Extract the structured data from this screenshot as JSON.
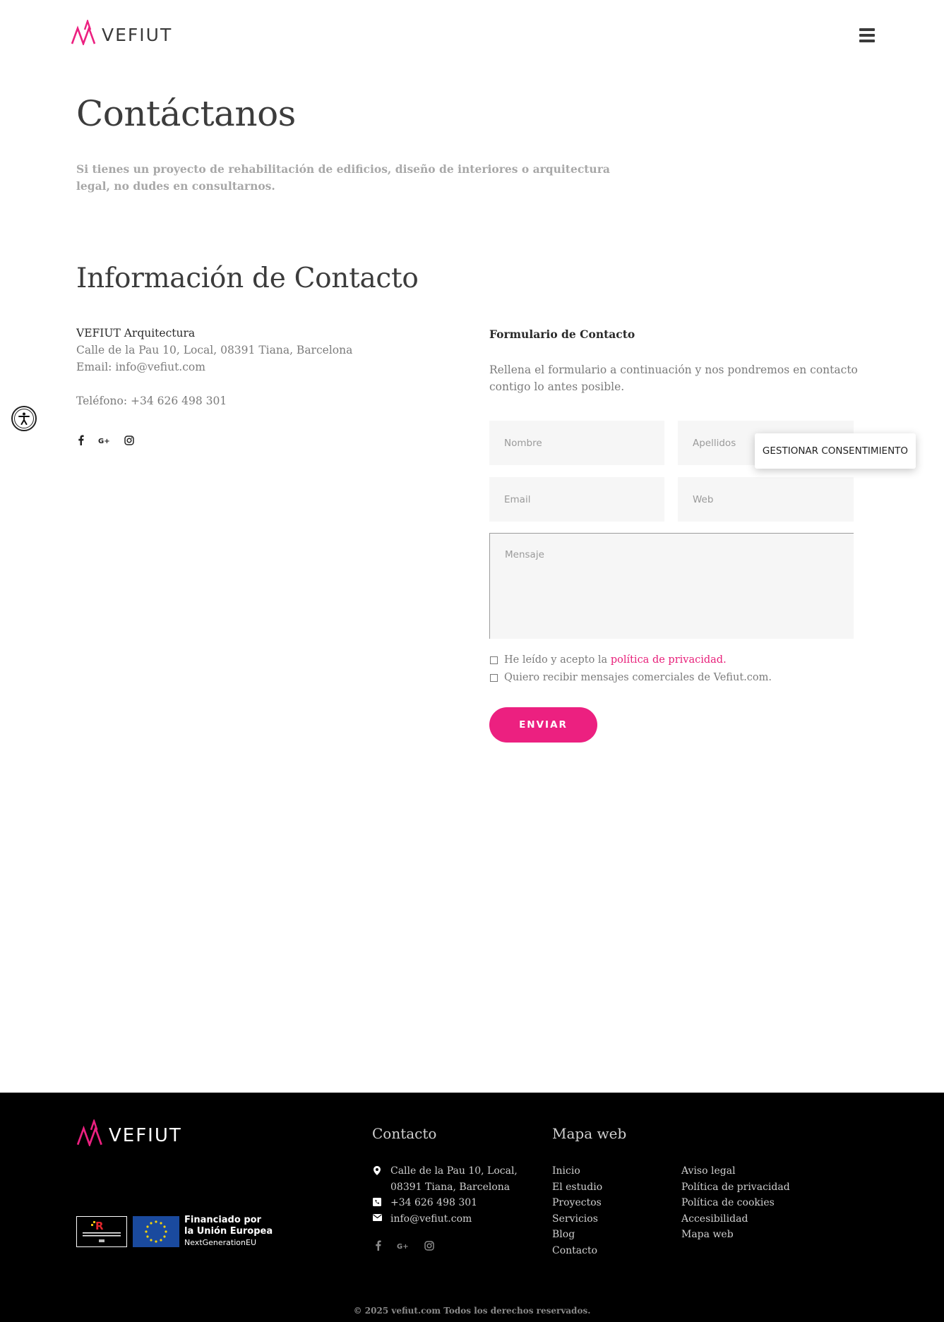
{
  "header": {
    "logo_text": "VEFIUT",
    "menu_icon": "hamburger-icon"
  },
  "page": {
    "title": "Contáctanos",
    "intro": "Si tienes un proyecto de rehabilitación de edificios, diseño de interiores o arquitectura legal, no dudes en consultarnos."
  },
  "info": {
    "title": "Información de Contacto",
    "company": "VEFIUT Arquitectura",
    "address": "Calle de la Pau 10, Local, 08391 Tiana, Barcelona",
    "email": "Email: info@vefiut.com",
    "phone": "Teléfono: +34 626 498 301",
    "socials": [
      "facebook-icon",
      "google-plus-icon",
      "instagram-icon"
    ]
  },
  "form": {
    "title": "Formulario de Contacto",
    "description": "Rellena el formulario a continuación y nos pondremos en contacto contigo lo antes posible.",
    "name_placeholder": "Nombre",
    "surname_placeholder": "Apellidos",
    "email_placeholder": "Email",
    "web_placeholder": "Web",
    "message_placeholder": "Mensaje",
    "privacy_prefix": "He leído y acepto la ",
    "privacy_link": "política de privacidad.",
    "commercial_label": "Quiero recibir mensajes comerciales de Vefiut.com.",
    "submit_label": "ENVIAR"
  },
  "consent": {
    "label": "GESTIONAR CONSENTIMIENTO"
  },
  "footer": {
    "logo_text": "VEFIUT",
    "badge_title_line1": "Financiado por",
    "badge_title_line2": "la Unión Europea",
    "badge_subtitle": "NextGenerationEU",
    "contact_heading": "Contacto",
    "contact_address_line1": "Calle de la Pau 10, Local,",
    "contact_address_line2": "08391 Tiana, Barcelona",
    "contact_phone": "+34 626 498 301",
    "contact_email": "info@vefiut.com",
    "sitemap_heading": "Mapa web",
    "sitemap_col1": [
      "Inicio",
      "El estudio",
      "Proyectos",
      "Servicios",
      "Blog",
      "Contacto"
    ],
    "sitemap_col2": [
      "Aviso legal",
      "Política de privacidad",
      "Política de cookies",
      "Accesibilidad",
      "Mapa web"
    ],
    "copyright": "© 2025 vefiut.com Todos los derechos reservados."
  },
  "colors": {
    "accent": "#ec2080",
    "footer_bg": "#000000",
    "field_bg": "#f6f6f6"
  }
}
